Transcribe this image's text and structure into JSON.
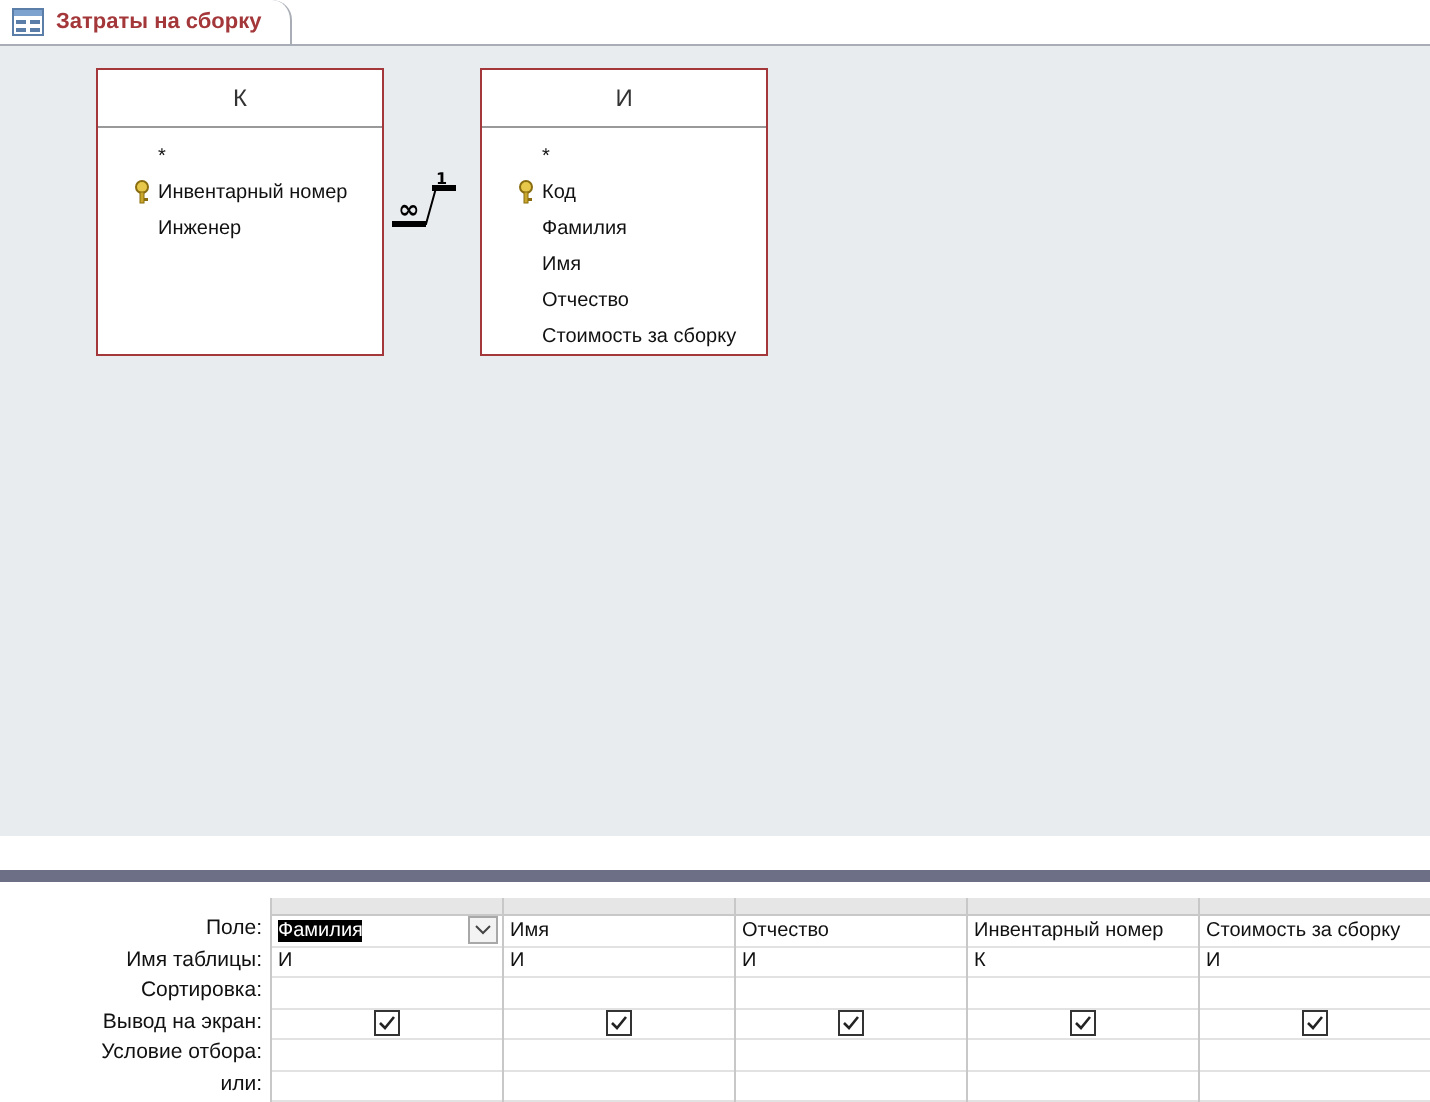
{
  "tab": {
    "title": "Затраты на сборку",
    "selected": true
  },
  "tables": [
    {
      "name": "К",
      "fields": [
        {
          "name": "*",
          "key": false
        },
        {
          "name": "Инвентарный номер",
          "key": true
        },
        {
          "name": "Инженер",
          "key": false
        }
      ]
    },
    {
      "name": "И",
      "fields": [
        {
          "name": "*",
          "key": false
        },
        {
          "name": "Код",
          "key": true
        },
        {
          "name": "Фамилия",
          "key": false
        },
        {
          "name": "Имя",
          "key": false
        },
        {
          "name": "Отчество",
          "key": false
        },
        {
          "name": "Стоимость за сборку",
          "key": false
        }
      ]
    }
  ],
  "relationship": {
    "many_label": "∞",
    "one_label": "1"
  },
  "grid": {
    "row_labels": [
      "Поле:",
      "Имя таблицы:",
      "Сортировка:",
      "Вывод на экран:",
      "Условие отбора:",
      "или:"
    ],
    "columns": [
      {
        "field": "Фамилия",
        "table": "И",
        "show": true,
        "selected": true
      },
      {
        "field": "Имя",
        "table": "И",
        "show": true,
        "selected": false
      },
      {
        "field": "Отчество",
        "table": "И",
        "show": true,
        "selected": false
      },
      {
        "field": "Инвентарный номер",
        "table": "К",
        "show": true,
        "selected": false
      },
      {
        "field": "Стоимость за сборку",
        "table": "И",
        "show": true,
        "selected": false
      }
    ]
  }
}
